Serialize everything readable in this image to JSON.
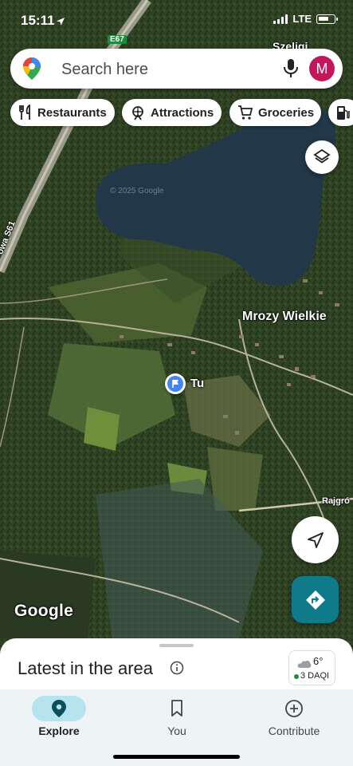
{
  "status_bar": {
    "time": "15:11",
    "network": "LTE"
  },
  "search": {
    "placeholder": "Search here",
    "avatar_initial": "M"
  },
  "chips": [
    {
      "label": "Restaurants",
      "icon": "fork-knife-icon"
    },
    {
      "label": "Attractions",
      "icon": "attraction-icon"
    },
    {
      "label": "Groceries",
      "icon": "cart-icon"
    },
    {
      "label": "",
      "icon": "gas-station-icon"
    }
  ],
  "map": {
    "labels": {
      "town_top": "Szeligi",
      "town": "Mrozy Wielkie",
      "road_e67": "E67",
      "road_s61": "owa S61",
      "road_right": "Rajgró",
      "pin_label": "Tu",
      "watermark": "© 2025 Google"
    },
    "colors": {
      "lake": "#223747",
      "forest": "#2f4224",
      "field": "#566b36",
      "accent": "#0f7a8a"
    }
  },
  "google_logo": "Google",
  "sheet": {
    "title": "Latest in the area",
    "weather_temp": "6°",
    "aqi": "3 DAQI"
  },
  "bottom_nav": [
    {
      "label": "Explore",
      "icon": "explore-pin-icon",
      "active": true
    },
    {
      "label": "You",
      "icon": "bookmark-icon",
      "active": false
    },
    {
      "label": "Contribute",
      "icon": "plus-circle-icon",
      "active": false
    }
  ]
}
